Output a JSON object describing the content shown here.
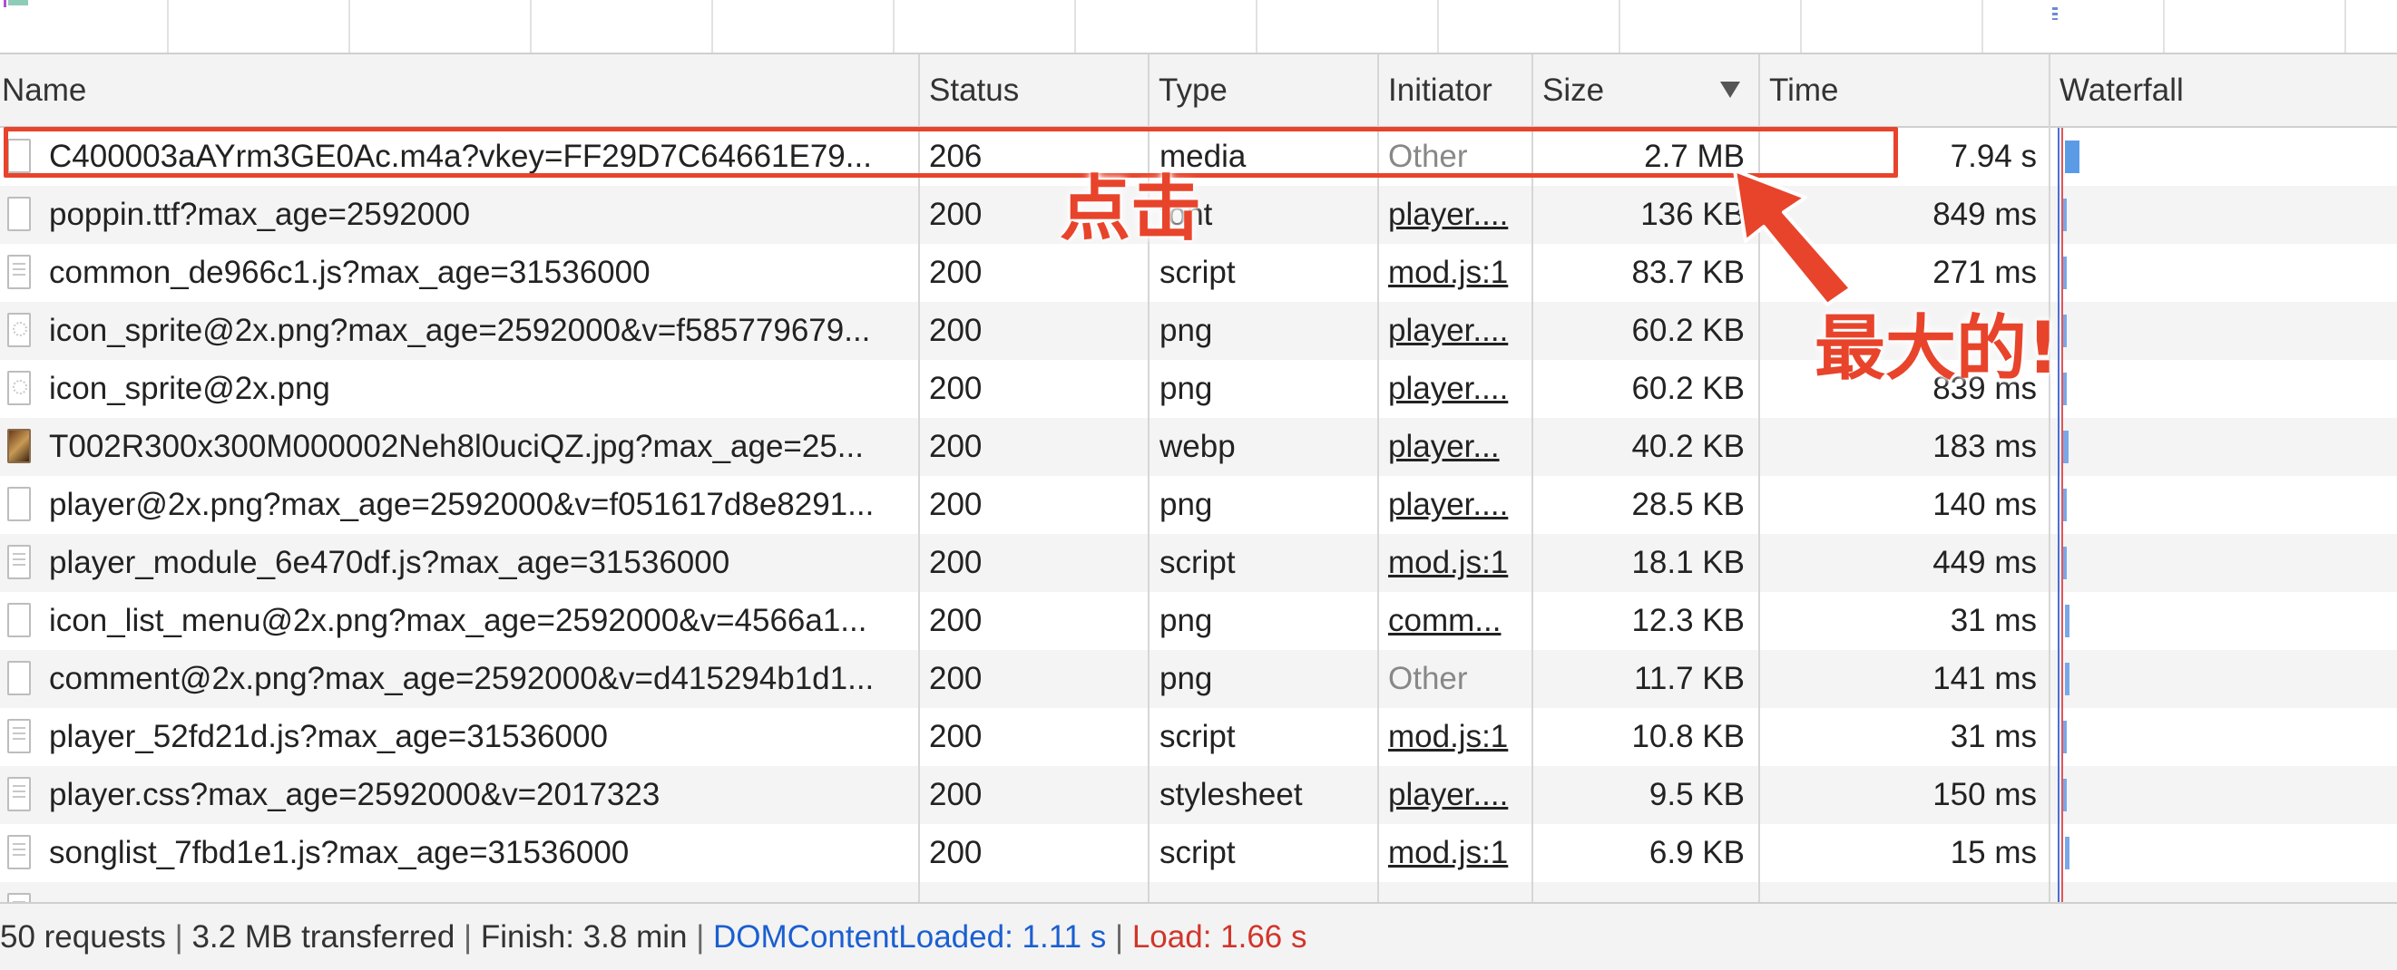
{
  "columns": {
    "name": "Name",
    "status": "Status",
    "type": "Type",
    "initiator": "Initiator",
    "size": "Size",
    "time": "Time",
    "waterfall": "Waterfall"
  },
  "rows": [
    {
      "name": "C400003aAYrm3GE0Ac.m4a?vkey=FF29D7C64661E79...",
      "status": "206",
      "type": "media",
      "initiator": "Other",
      "size": "2.7 MB",
      "time": "7.94 s",
      "icon": "file-icon"
    },
    {
      "name": "poppin.ttf?max_age=2592000",
      "status": "200",
      "type": "font",
      "initiator": "player....",
      "size": "136 KB",
      "time": "849 ms",
      "icon": "file-icon"
    },
    {
      "name": "common_de966c1.js?max_age=31536000",
      "status": "200",
      "type": "script",
      "initiator": "mod.js:1",
      "size": "83.7 KB",
      "time": "271 ms",
      "icon": "script-file-icon"
    },
    {
      "name": "icon_sprite@2x.png?max_age=2592000&v=f585779679...",
      "status": "200",
      "type": "png",
      "initiator": "player....",
      "size": "60.2 KB",
      "time": "",
      "icon": "image-file-icon"
    },
    {
      "name": "icon_sprite@2x.png",
      "status": "200",
      "type": "png",
      "initiator": "player....",
      "size": "60.2 KB",
      "time": "839 ms",
      "icon": "image-file-icon"
    },
    {
      "name": "T002R300x300M000002Neh8l0uciQZ.jpg?max_age=25...",
      "status": "200",
      "type": "webp",
      "initiator": "player...",
      "size": "40.2 KB",
      "time": "183 ms",
      "icon": "image-thumbnail-icon"
    },
    {
      "name": "player@2x.png?max_age=2592000&v=f051617d8e8291...",
      "status": "200",
      "type": "png",
      "initiator": "player....",
      "size": "28.5 KB",
      "time": "140 ms",
      "icon": "file-icon"
    },
    {
      "name": "player_module_6e470df.js?max_age=31536000",
      "status": "200",
      "type": "script",
      "initiator": "mod.js:1",
      "size": "18.1 KB",
      "time": "449 ms",
      "icon": "script-file-icon"
    },
    {
      "name": "icon_list_menu@2x.png?max_age=2592000&v=4566a1...",
      "status": "200",
      "type": "png",
      "initiator": "comm...",
      "size": "12.3 KB",
      "time": "31 ms",
      "icon": "file-icon"
    },
    {
      "name": "comment@2x.png?max_age=2592000&v=d415294b1d1...",
      "status": "200",
      "type": "png",
      "initiator": "Other",
      "size": "11.7 KB",
      "time": "141 ms",
      "icon": "file-icon"
    },
    {
      "name": "player_52fd21d.js?max_age=31536000",
      "status": "200",
      "type": "script",
      "initiator": "mod.js:1",
      "size": "10.8 KB",
      "time": "31 ms",
      "icon": "script-file-icon"
    },
    {
      "name": "player.css?max_age=2592000&v=2017323",
      "status": "200",
      "type": "stylesheet",
      "initiator": "player....",
      "size": "9.5 KB",
      "time": "150 ms",
      "icon": "stylesheet-file-icon"
    },
    {
      "name": "songlist_7fbd1e1.js?max_age=31536000",
      "status": "200",
      "type": "script",
      "initiator": "mod.js:1",
      "size": "6.9 KB",
      "time": "15 ms",
      "icon": "script-file-icon"
    },
    {
      "name": "",
      "status": "",
      "type": "",
      "initiator": "",
      "size": "",
      "time": "",
      "icon": "script-file-icon"
    }
  ],
  "status_bar": {
    "requests": "50 requests",
    "transferred": "3.2 MB transferred",
    "finish": "Finish: 3.8 min",
    "dom_content_loaded": "DOMContentLoaded: 1.11 s",
    "load": "Load: 1.66 s",
    "separator": "|"
  },
  "annotations": {
    "click": "点击",
    "largest": "最大的!"
  },
  "colors": {
    "annotation": "#e8442b",
    "dom_content_loaded": "#1a5fd1",
    "load": "#d1352b"
  }
}
